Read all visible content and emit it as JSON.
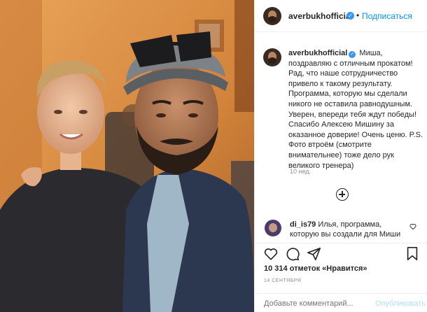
{
  "post": {
    "username": "averbukhofficial",
    "follow_label": "Подписаться",
    "separator": "•",
    "verified_mark": "✓"
  },
  "caption": {
    "username": "averbukhofficial",
    "text": "Миша, поздравляю с отличным прокатом! Рад, что наше сотрудничество привело к такому результату. Программа, которую мы сделали никого не оставила равнодушным. Уверен, впереди тебя ждут победы! Спасибо Алексею Мишину за оказанное доверие! Очень ценю. P.S. Фото втроём (смотрите внимательнее) тоже дело рук великого тренера)",
    "time": "10 нед."
  },
  "comment": {
    "username": "di_is79",
    "text": "Илья, программа, которую вы создали для Миши"
  },
  "actions": {
    "like_icon": "heart-icon",
    "comment_icon": "comment-icon",
    "share_icon": "share-icon",
    "save_icon": "bookmark-icon",
    "load_more_icon": "plus-circle-icon"
  },
  "likes": {
    "count": "10 314",
    "label": "отметок «Нравится»"
  },
  "date": "14 СЕНТЯБРЯ",
  "add_comment": {
    "placeholder": "Добавьте комментарий...",
    "publish_label": "Опубликовать"
  },
  "colors": {
    "accent": "#0095f6",
    "verified": "#3897f0",
    "muted": "#8e8e8e",
    "publish_disabled": "#b2dffc"
  }
}
